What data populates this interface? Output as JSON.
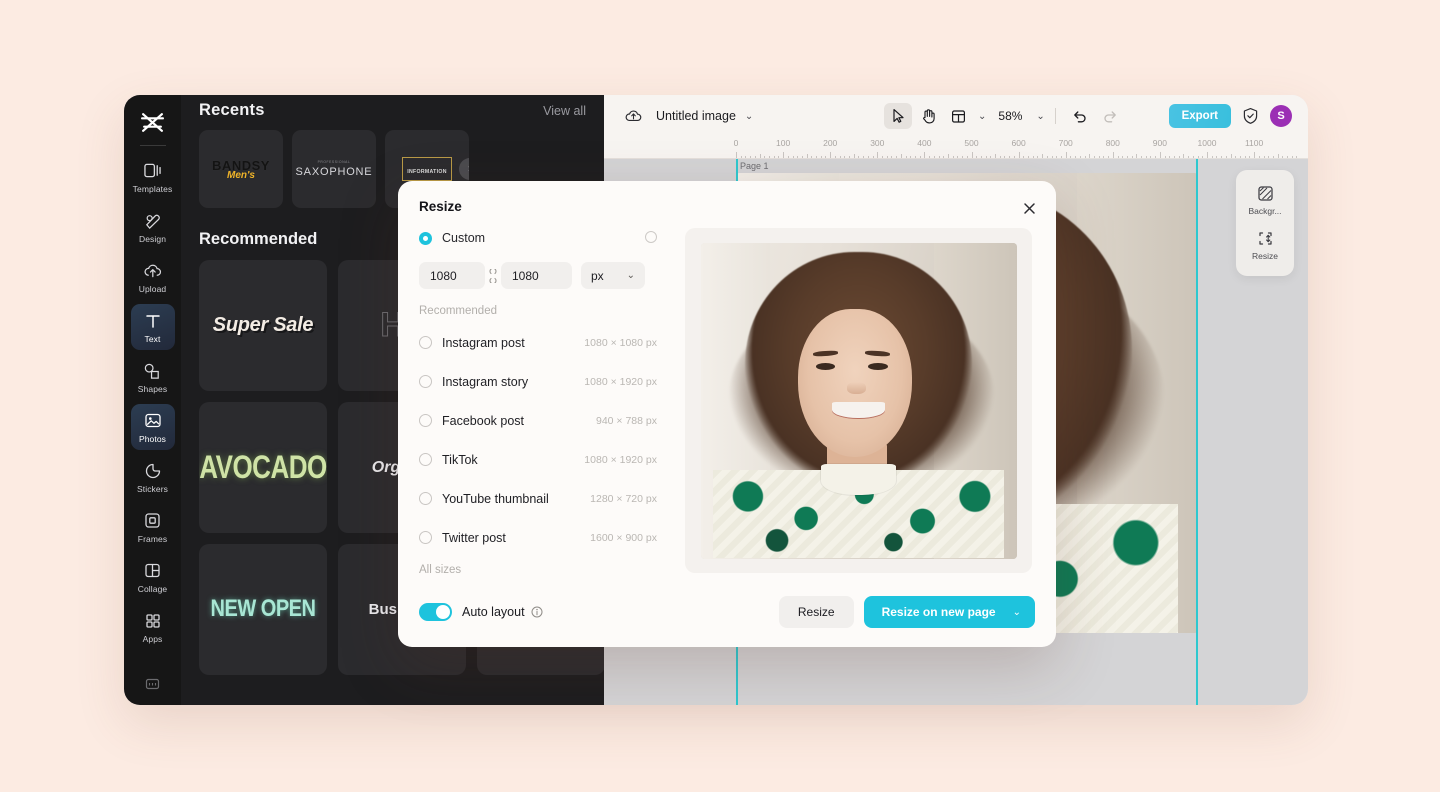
{
  "theme": {
    "page_background": "#fcebe2",
    "accent": "#1ec3dd",
    "panel_dark": "#1d1d1f",
    "rail_dark": "#161616",
    "canvas_gray": "#d4d4d6",
    "guide_cyan": "#2ec8cf",
    "avatar_purple": "#9b2fb4"
  },
  "rail": {
    "logo_icon": "capcut-logo-icon",
    "items": [
      {
        "label": "Templates",
        "icon": "templates-icon",
        "active": false
      },
      {
        "label": "Design",
        "icon": "design-icon",
        "active": false
      },
      {
        "label": "Upload",
        "icon": "upload-cloud-icon",
        "active": false
      },
      {
        "label": "Text",
        "icon": "text-icon",
        "active": true
      },
      {
        "label": "Shapes",
        "icon": "shapes-icon",
        "active": false
      },
      {
        "label": "Photos",
        "icon": "photos-icon",
        "active": true
      },
      {
        "label": "Stickers",
        "icon": "stickers-icon",
        "active": false
      },
      {
        "label": "Frames",
        "icon": "frames-icon",
        "active": false
      },
      {
        "label": "Collage",
        "icon": "collage-icon",
        "active": false
      },
      {
        "label": "Apps",
        "icon": "apps-grid-icon",
        "active": false
      }
    ],
    "bottom_icon": "keyboard-icon"
  },
  "panel": {
    "recents_title": "Recents",
    "view_all": "View all",
    "recents": [
      {
        "line1": "BANDSY",
        "line2": "Men's"
      },
      {
        "line0": "PROFESSIONAL",
        "line1": "SAXOPHONE"
      },
      {
        "line1": "INFORMATION"
      }
    ],
    "recommended_title": "Recommended",
    "recommended": [
      {
        "label": "Super Sale",
        "style": "super"
      },
      {
        "label": "Ho",
        "style": "outline"
      },
      {
        "label": "",
        "style": "blank"
      },
      {
        "label": "AVOCADO",
        "style": "avocado"
      },
      {
        "label": "Organic",
        "style": "organic"
      },
      {
        "label": "",
        "style": "blank"
      },
      {
        "label": "NEW OPEN",
        "style": "newopen"
      },
      {
        "label": "Business",
        "style": "business"
      },
      {
        "label": "",
        "style": "blank"
      }
    ]
  },
  "topbar": {
    "cloud_icon": "cloud-sync-icon",
    "document_title": "Untitled image",
    "title_chevron": "chevron-down-icon",
    "tools": [
      {
        "name": "select-tool",
        "icon": "cursor-arrow-icon",
        "selected": true
      },
      {
        "name": "hand-tool",
        "icon": "hand-icon",
        "selected": false
      },
      {
        "name": "layout-tool",
        "icon": "layout-panel-icon",
        "selected": false
      }
    ],
    "zoom_level": "58%",
    "zoom_chevron": "chevron-down-icon",
    "undo_icon": "undo-icon",
    "redo_icon": "redo-icon",
    "export_label": "Export",
    "shield_icon": "shield-check-icon",
    "avatar_label": "S"
  },
  "ruler": {
    "ticks": [
      "0",
      "100",
      "200",
      "300",
      "400",
      "500",
      "600",
      "700",
      "800",
      "900",
      "1000",
      "1100"
    ]
  },
  "canvas": {
    "page_label": "Page 1"
  },
  "right_tools": [
    {
      "label": "Backgr...",
      "icon": "background-icon"
    },
    {
      "label": "Resize",
      "icon": "resize-icon"
    }
  ],
  "modal": {
    "title": "Resize",
    "close_icon": "close-icon",
    "custom_label": "Custom",
    "custom_selected": true,
    "reset_icon": "reset-circle-icon",
    "width_value": "1080",
    "height_value": "1080",
    "link_icon": "link-aspect-icon",
    "unit_value": "px",
    "unit_chevron": "chevron-down-icon",
    "recommended_label": "Recommended",
    "presets": [
      {
        "label": "Instagram post",
        "dimensions": "1080 × 1080 px",
        "selected": false
      },
      {
        "label": "Instagram story",
        "dimensions": "1080 × 1920 px",
        "selected": false
      },
      {
        "label": "Facebook post",
        "dimensions": "940 × 788 px",
        "selected": false
      },
      {
        "label": "TikTok",
        "dimensions": "1080 × 1920 px",
        "selected": false
      },
      {
        "label": "YouTube thumbnail",
        "dimensions": "1280 × 720 px",
        "selected": false
      },
      {
        "label": "Twitter post",
        "dimensions": "1600 × 900 px",
        "selected": false
      }
    ],
    "all_sizes_label": "All sizes",
    "auto_layout_label": "Auto layout",
    "auto_layout_on": true,
    "info_icon": "info-icon",
    "resize_button": "Resize",
    "resize_new_page_button": "Resize on new page",
    "primary_chevron": "chevron-down-icon",
    "preview_alt": "smiling-woman-portrait"
  }
}
